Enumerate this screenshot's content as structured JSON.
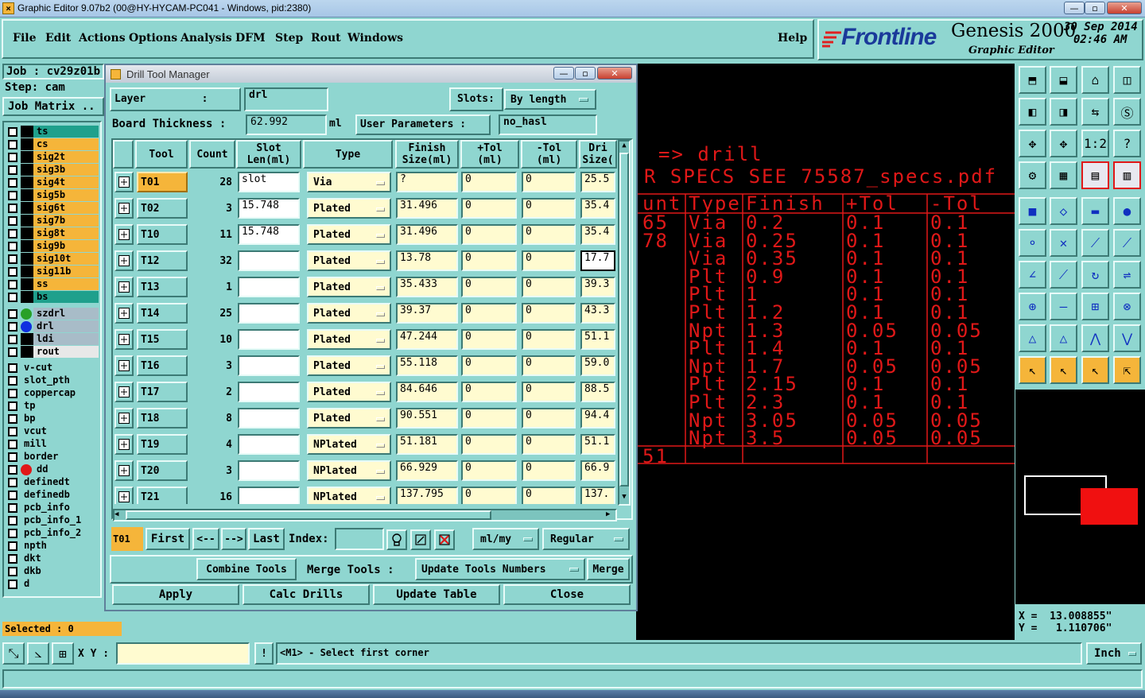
{
  "window": {
    "title": "Graphic Editor 9.07b2 (00@HY-HYCAM-PC041 - Windows, pid:2380)"
  },
  "menu": [
    "File",
    "Edit",
    "Actions",
    "Options",
    "Analysis",
    "DFM",
    "Step",
    "Rout",
    "Windows"
  ],
  "help": "Help",
  "brand": {
    "logo": "Frontline",
    "product": "Genesis 2000",
    "subtitle": "Graphic Editor",
    "date": "30 Sep 2014",
    "time": "02:46 AM"
  },
  "job": {
    "label": "Job : cv29z01b",
    "step": "Step: cam",
    "matrix": "Job Matrix .."
  },
  "layers_board": [
    "ts",
    "cs",
    "sig2t",
    "sig3b",
    "sig4t",
    "sig5b",
    "sig6t",
    "sig7b",
    "sig8t",
    "sig9b",
    "sig10t",
    "sig11b",
    "ss",
    "bs"
  ],
  "layers_drill": [
    "szdrl",
    "drl",
    "ldi",
    "rout"
  ],
  "layers_misc": [
    "v-cut",
    "slot_pth",
    "coppercap",
    "tp",
    "bp",
    "vcut",
    "mill",
    "border",
    "dd",
    "definedt",
    "definedb",
    "pcb_info",
    "pcb_info_1",
    "pcb_info_2",
    "npth",
    "dkt",
    "dkb",
    "d"
  ],
  "selected": "Selected : 0",
  "dialog": {
    "title": "Drill Tool Manager",
    "layer_label": "Layer         :",
    "layer_value": "drl",
    "slots_label": "Slots:",
    "slots_value": "By length",
    "thickness_label": "Board Thickness :",
    "thickness_value": "62.992",
    "thickness_unit": "ml",
    "user_params_label": "User Parameters :",
    "user_params_value": "no_hasl",
    "columns": [
      "Tool",
      "Count",
      "Slot Len(ml)",
      "Type",
      "Finish Size(ml)",
      "+Tol (ml)",
      "-Tol (ml)",
      "Dri Size("
    ],
    "rows": [
      {
        "tool": "T01",
        "count": "28",
        "slot": "slot",
        "type": "Via",
        "finish": "?",
        "ptol": "0",
        "mtol": "0",
        "drill": "25.5"
      },
      {
        "tool": "T02",
        "count": "3",
        "slot": "15.748",
        "type": "Plated",
        "finish": "31.496",
        "ptol": "0",
        "mtol": "0",
        "drill": "35.4"
      },
      {
        "tool": "T10",
        "count": "11",
        "slot": "15.748",
        "type": "Plated",
        "finish": "31.496",
        "ptol": "0",
        "mtol": "0",
        "drill": "35.4"
      },
      {
        "tool": "T12",
        "count": "32",
        "slot": "",
        "type": "Plated",
        "finish": "13.78",
        "ptol": "0",
        "mtol": "0",
        "drill": "17.7"
      },
      {
        "tool": "T13",
        "count": "1",
        "slot": "",
        "type": "Plated",
        "finish": "35.433",
        "ptol": "0",
        "mtol": "0",
        "drill": "39.3"
      },
      {
        "tool": "T14",
        "count": "25",
        "slot": "",
        "type": "Plated",
        "finish": "39.37",
        "ptol": "0",
        "mtol": "0",
        "drill": "43.3"
      },
      {
        "tool": "T15",
        "count": "10",
        "slot": "",
        "type": "Plated",
        "finish": "47.244",
        "ptol": "0",
        "mtol": "0",
        "drill": "51.1"
      },
      {
        "tool": "T16",
        "count": "3",
        "slot": "",
        "type": "Plated",
        "finish": "55.118",
        "ptol": "0",
        "mtol": "0",
        "drill": "59.0"
      },
      {
        "tool": "T17",
        "count": "2",
        "slot": "",
        "type": "Plated",
        "finish": "84.646",
        "ptol": "0",
        "mtol": "0",
        "drill": "88.5"
      },
      {
        "tool": "T18",
        "count": "8",
        "slot": "",
        "type": "Plated",
        "finish": "90.551",
        "ptol": "0",
        "mtol": "0",
        "drill": "94.4"
      },
      {
        "tool": "T19",
        "count": "4",
        "slot": "",
        "type": "NPlated",
        "finish": "51.181",
        "ptol": "0",
        "mtol": "0",
        "drill": "51.1"
      },
      {
        "tool": "T20",
        "count": "3",
        "slot": "",
        "type": "NPlated",
        "finish": "66.929",
        "ptol": "0",
        "mtol": "0",
        "drill": "66.9"
      },
      {
        "tool": "T21",
        "count": "16",
        "slot": "",
        "type": "NPlated",
        "finish": "137.795",
        "ptol": "0",
        "mtol": "0",
        "drill": "137."
      }
    ],
    "current_tool": "T01",
    "nav": {
      "first": "First",
      "prev": "<--",
      "next": "-->",
      "last": "Last",
      "index_label": "Index:"
    },
    "units": "ml/my",
    "mode": "Regular",
    "combine": "Combine Tools",
    "merge_label": "Merge Tools :",
    "merge_option": "Update Tools Numbers",
    "merge": "Merge",
    "apply": "Apply",
    "calc": "Calc Drills",
    "update": "Update Table",
    "close": "Close"
  },
  "canvas": {
    "line1": "=> drill",
    "line2": "R SPECS SEE 75587_specs.pdf",
    "header": [
      "unt",
      "Type",
      "Finish",
      "+Tol",
      "-Tol"
    ],
    "rows": [
      [
        "65",
        "Via",
        "0.2",
        "0.1",
        "0.1"
      ],
      [
        "78",
        "Via",
        "0.25",
        "0.1",
        "0.1"
      ],
      [
        "",
        "Via",
        "0.35",
        "0.1",
        "0.1"
      ],
      [
        "",
        "Plt",
        "0.9",
        "0.1",
        "0.1"
      ],
      [
        "",
        "Plt",
        "1",
        "0.1",
        "0.1"
      ],
      [
        "",
        "Plt",
        "1.2",
        "0.1",
        "0.1"
      ],
      [
        "",
        "Npt",
        "1.3",
        "0.05",
        "0.05"
      ],
      [
        "",
        "Plt",
        "1.4",
        "0.1",
        "0.1"
      ],
      [
        "",
        "Npt",
        "1.7",
        "0.05",
        "0.05"
      ],
      [
        "",
        "Plt",
        "2.15",
        "0.1",
        "0.1"
      ],
      [
        "",
        "Plt",
        "2.3",
        "0.1",
        "0.1"
      ],
      [
        "",
        "Npt",
        "3.05",
        "0.05",
        "0.05"
      ],
      [
        "",
        "Npt",
        "3.5",
        "0.05",
        "0.05"
      ]
    ],
    "total": "51"
  },
  "coords": {
    "x": "X =  13.008855\"",
    "y": "Y =   1.110706\""
  },
  "status": {
    "xy_label": "X Y :",
    "message": "<M1> - Select first corner",
    "unit": "Inch"
  },
  "colors": {
    "panel": "#8fd6d0",
    "tool": "#f5b53a",
    "field": "#fffbd0",
    "canvas_text": "#e01818"
  }
}
